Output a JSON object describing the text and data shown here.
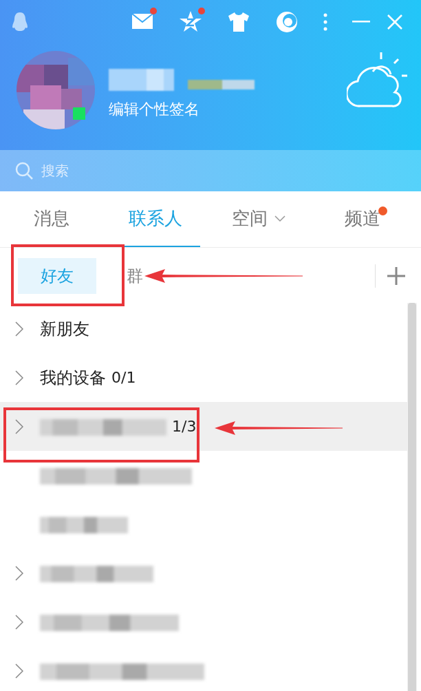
{
  "toolbar": [
    {
      "kind": "mail",
      "badge": true
    },
    {
      "kind": "star",
      "badge": true
    },
    {
      "kind": "shirt",
      "badge": false
    },
    {
      "kind": "moon",
      "badge": false
    }
  ],
  "profile": {
    "signature": "编辑个性签名",
    "online": true
  },
  "search": {
    "placeholder": "搜索"
  },
  "tabs": [
    {
      "label": "消息",
      "selected": false,
      "dropdown": false,
      "dot": false
    },
    {
      "label": "联系人",
      "selected": true,
      "dropdown": false,
      "dot": false
    },
    {
      "label": "空间",
      "selected": false,
      "dropdown": true,
      "dot": false
    },
    {
      "label": "频道",
      "selected": false,
      "dropdown": false,
      "dot": true
    }
  ],
  "subtabs": [
    {
      "label": "好友",
      "selected": true,
      "boxed": true,
      "arrow": false
    },
    {
      "label": "群",
      "selected": false,
      "boxed": false,
      "arrow": true
    }
  ],
  "groups": [
    {
      "label": "新朋友",
      "blurred": false,
      "chevron": true,
      "highlighted": false,
      "boxed": false,
      "arrow": false
    },
    {
      "label": "我的设备",
      "count": "0/1",
      "blurred": false,
      "chevron": true,
      "highlighted": false,
      "boxed": false,
      "arrow": false
    },
    {
      "count": "1/3",
      "blurred": true,
      "chevron": true,
      "highlighted": true,
      "boxed": true,
      "arrow": true
    },
    {
      "blurred": true,
      "chevron": false,
      "highlighted": false,
      "boxed": false,
      "arrow": false
    },
    {
      "blurred": true,
      "chevron": false,
      "highlighted": false,
      "boxed": false,
      "arrow": false
    },
    {
      "blurred": true,
      "chevron": true,
      "highlighted": false,
      "boxed": false,
      "arrow": false
    },
    {
      "blurred": true,
      "chevron": true,
      "highlighted": false,
      "boxed": false,
      "arrow": false
    },
    {
      "blurred": true,
      "chevron": true,
      "highlighted": false,
      "boxed": false,
      "arrow": false
    }
  ]
}
